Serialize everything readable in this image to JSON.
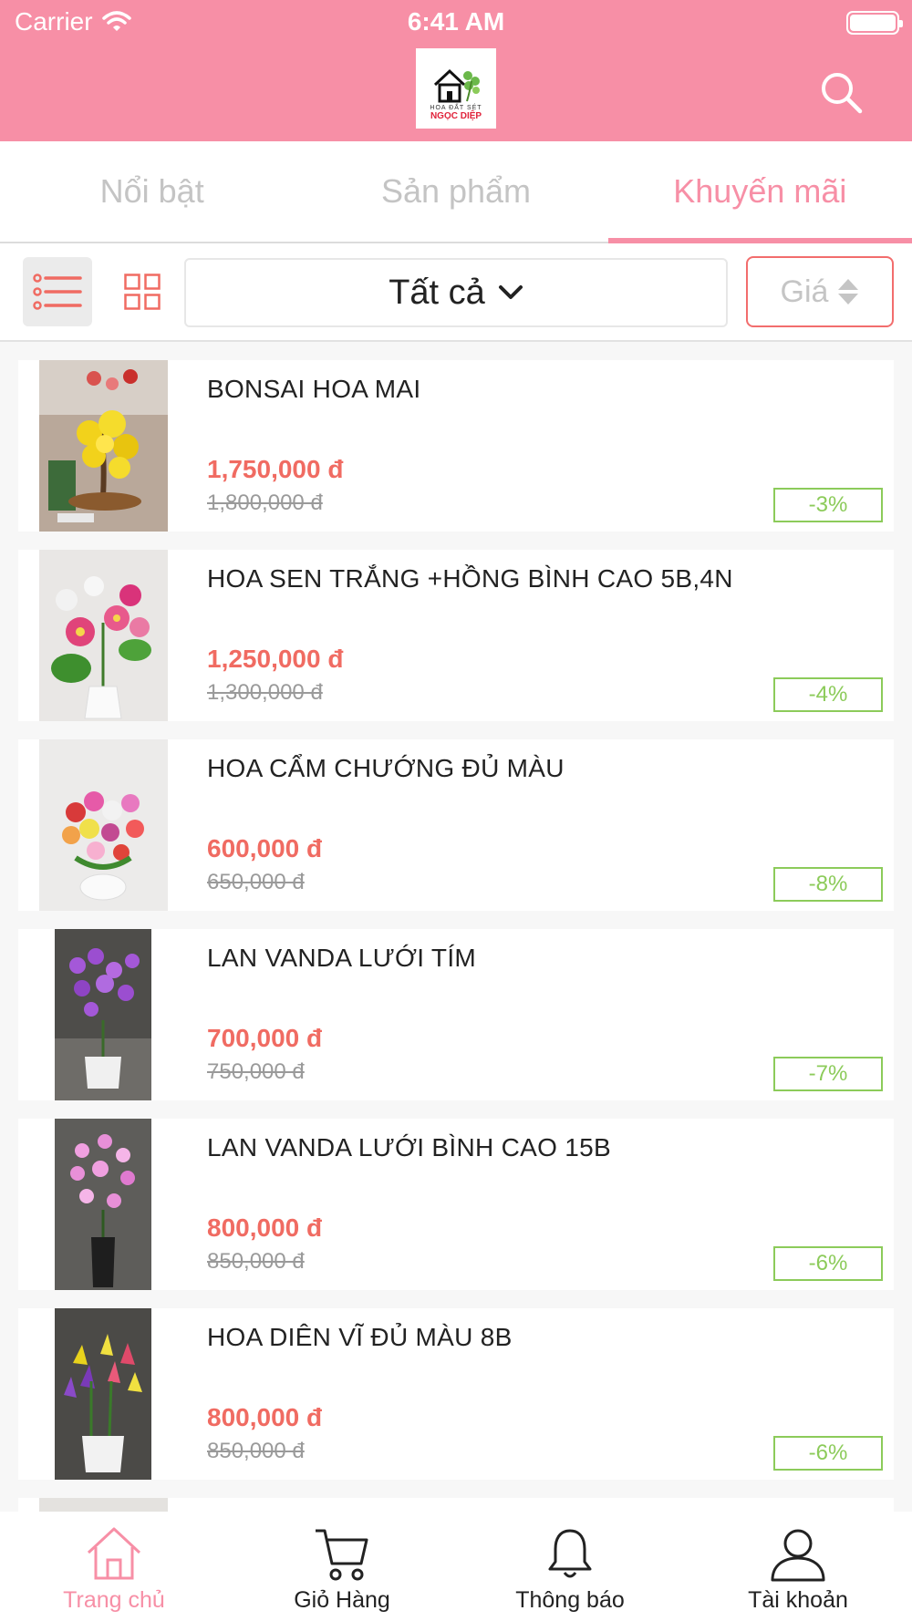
{
  "status_bar": {
    "carrier": "Carrier",
    "time": "6:41 AM"
  },
  "logo": {
    "line1": "HOA ĐẤT SÉT",
    "line2": "NGỌC DIỆP"
  },
  "tabs": [
    {
      "label": "Nổi bật"
    },
    {
      "label": "Sản phẩm"
    },
    {
      "label": "Khuyến mãi"
    }
  ],
  "filter": {
    "category": "Tất cả",
    "sort_label": "Giá"
  },
  "products": [
    {
      "name": "BONSAI HOA MAI",
      "price": "1,750,000 đ",
      "old_price": "1,800,000 đ",
      "discount": "-3%"
    },
    {
      "name": "HOA SEN TRẮNG +HỒNG BÌNH CAO 5B,4N",
      "price": "1,250,000 đ",
      "old_price": "1,300,000 đ",
      "discount": "-4%"
    },
    {
      "name": "HOA CẨM CHƯỚNG ĐỦ MÀU",
      "price": "600,000 đ",
      "old_price": "650,000 đ",
      "discount": "-8%"
    },
    {
      "name": "LAN VANDA LƯỚI TÍM",
      "price": "700,000 đ",
      "old_price": "750,000 đ",
      "discount": "-7%"
    },
    {
      "name": "LAN VANDA LƯỚI BÌNH CAO 15B",
      "price": "800,000 đ",
      "old_price": "850,000 đ",
      "discount": "-6%"
    },
    {
      "name": "HOA DIÊN VĨ ĐỦ MÀU 8B",
      "price": "800,000 đ",
      "old_price": "850,000 đ",
      "discount": "-6%"
    }
  ],
  "bottom_nav": [
    {
      "label": "Trang chủ",
      "icon": "home-icon"
    },
    {
      "label": "Giỏ Hàng",
      "icon": "cart-icon"
    },
    {
      "label": "Thông báo",
      "icon": "bell-icon"
    },
    {
      "label": "Tài khoản",
      "icon": "user-icon"
    }
  ],
  "colors": {
    "brand_pink": "#f78fa6",
    "price_red": "#f06b62",
    "discount_green": "#8ccb5a",
    "sort_border": "#f26d6d"
  }
}
